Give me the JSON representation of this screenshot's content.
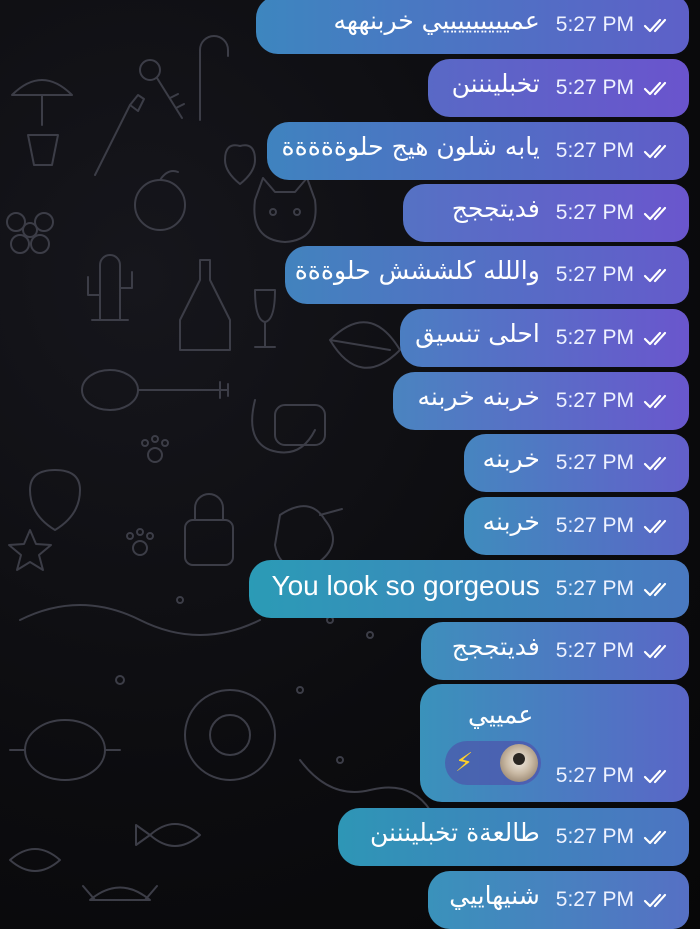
{
  "colors": {
    "background": "#0a0a0c",
    "bubble_gradient_left": "#2e9ab5",
    "bubble_gradient_right": "#6e4fd0",
    "reaction_bolt": "#ffd02a"
  },
  "icons": {
    "read_status": "double-check-icon",
    "reaction": "lightning-bolt-icon",
    "reactor": "avatar"
  },
  "messages": [
    {
      "text": "عميييييييييي خربنههه",
      "time": "5:27 PM"
    },
    {
      "text": "تخبلينننن",
      "time": "5:27 PM"
    },
    {
      "text": "يابه شلون هيج حلوةةةةة",
      "time": "5:27 PM"
    },
    {
      "text": "فديتججج",
      "time": "5:27 PM"
    },
    {
      "text": "واللله كلششش حلوةةة",
      "time": "5:27 PM"
    },
    {
      "text": "احلى تنسيق",
      "time": "5:27 PM"
    },
    {
      "text": "خربنه خربنه",
      "time": "5:27 PM"
    },
    {
      "text": "خربنه",
      "time": "5:27 PM"
    },
    {
      "text": "خربنه",
      "time": "5:27 PM"
    },
    {
      "text": "You look so gorgeous",
      "time": "5:27 PM"
    },
    {
      "text": "فديتججج",
      "time": "5:27 PM"
    },
    {
      "text": "عمييي",
      "time": "5:27 PM",
      "reaction": "⚡"
    },
    {
      "text": "طالعةة تخبلينننن",
      "time": "5:27 PM"
    },
    {
      "text": "شنيهاييي",
      "time": "5:27 PM"
    }
  ]
}
